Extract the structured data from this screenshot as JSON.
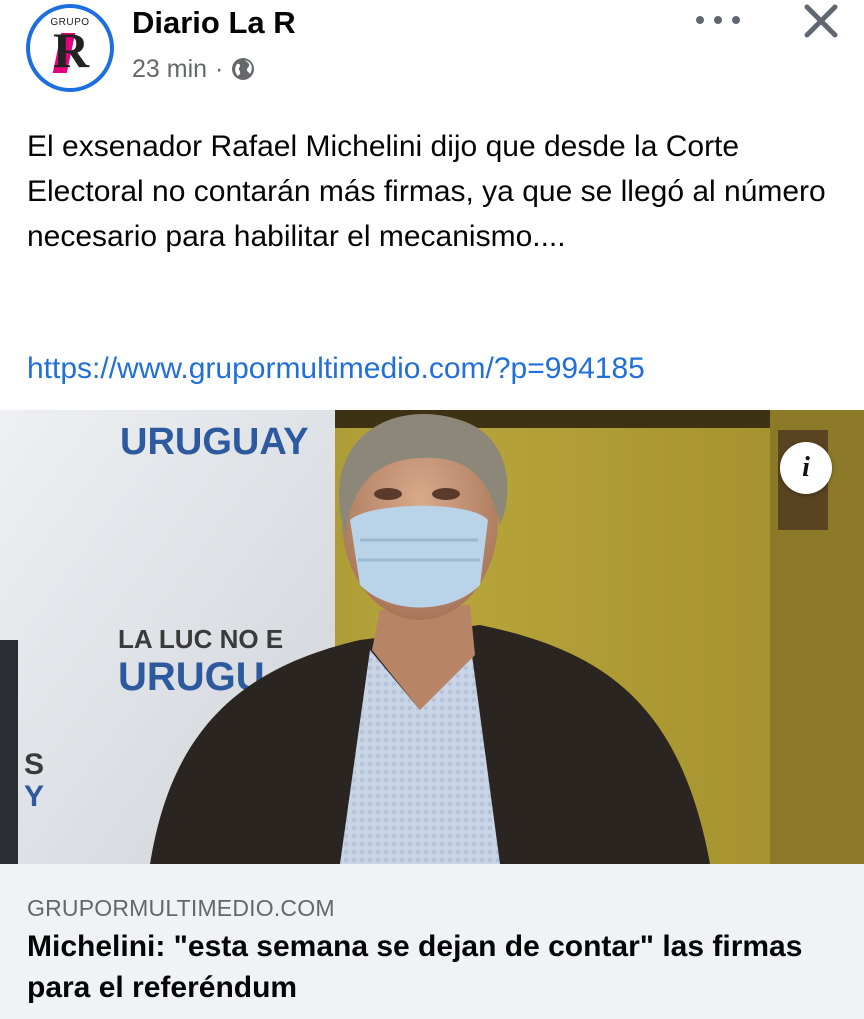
{
  "post": {
    "page_name": "Diario La R",
    "logo_text": "GRUPO",
    "logo_letter": "R",
    "time": "23 min",
    "separator": "·",
    "audience_icon": "globe-icon",
    "more_icon": "more-options-icon",
    "close_icon": "close-icon",
    "body": "El exsenador Rafael Michelini dijo que desde la Corte Electoral no contarán más firmas, ya que se llegó al número necesario para habilitar el mecanismo....",
    "link": "https://www.grupormultimedio.com/?p=994185"
  },
  "image": {
    "banner_top": "URUGUAY",
    "banner_mid_1": "LA LUC NO E",
    "banner_mid_2": "URUGU",
    "banner_edge_1": "S",
    "banner_edge_2": "Y",
    "info_label": "i"
  },
  "link_preview": {
    "domain": "GRUPORMULTIMEDIO.COM",
    "headline": "Michelini: \"esta semana se dejan de contar\" las firmas para el referéndum"
  },
  "colors": {
    "accent": "#1d6fe0",
    "link": "#216fdb",
    "meta": "#65676b",
    "card_bg": "#f0f2f5",
    "logo_magenta": "#e6007e"
  }
}
